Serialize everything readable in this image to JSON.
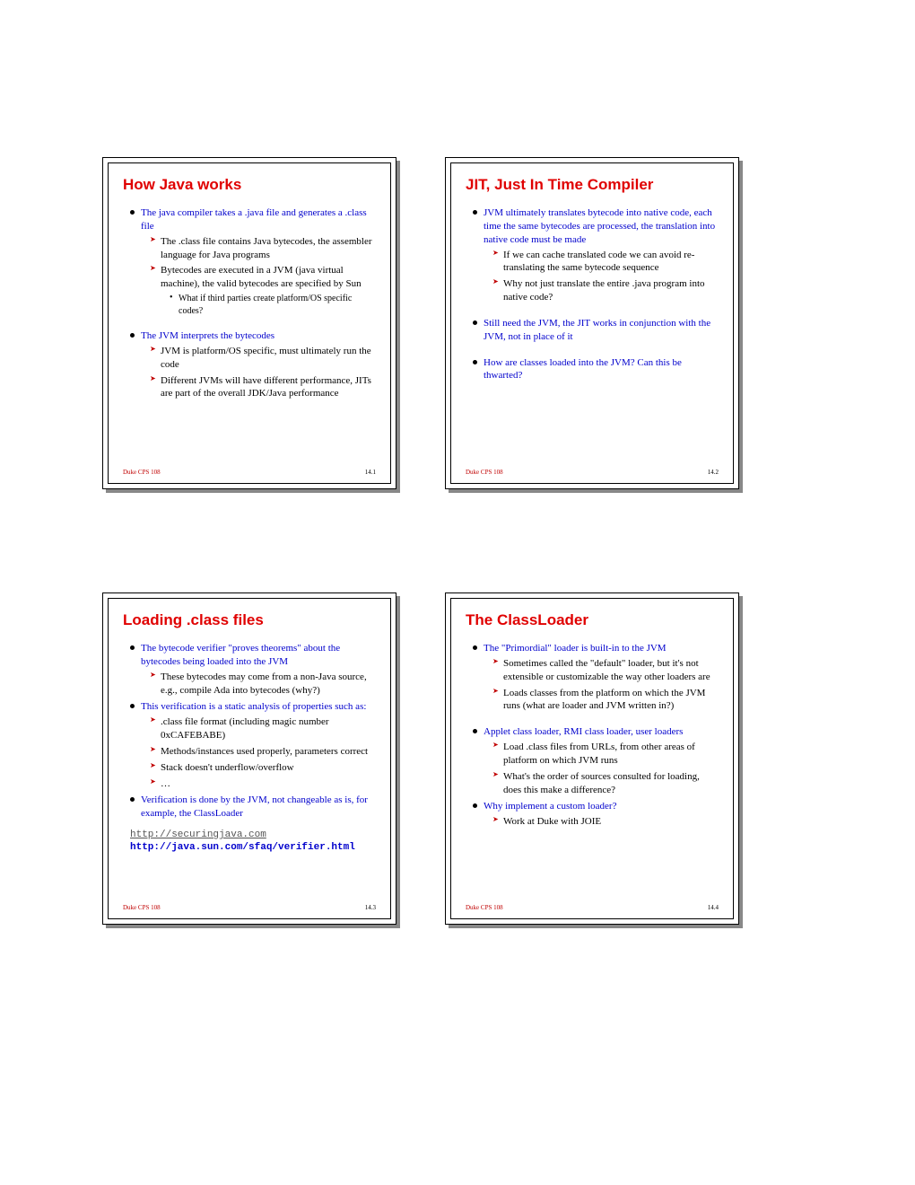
{
  "footer_course": "Duke CPS 108",
  "slides": [
    {
      "title": "How Java works",
      "page": "14.1",
      "bullets": [
        {
          "text": "The java compiler takes a .java file and generates a .class file",
          "sub": [
            {
              "text": "The .class file contains Java bytecodes, the assembler language for Java programs"
            },
            {
              "text": "Bytecodes are executed in a JVM (java virtual machine), the valid bytecodes are specified by Sun",
              "sub": [
                {
                  "text": "What if third parties create platform/OS specific codes?"
                }
              ]
            }
          ]
        },
        {
          "gap": true
        },
        {
          "text": "The JVM interprets the bytecodes",
          "sub": [
            {
              "text": "JVM is platform/OS specific, must ultimately run the code"
            },
            {
              "text": "Different JVMs will have different performance, JITs are part of the overall JDK/Java performance"
            }
          ]
        }
      ]
    },
    {
      "title": "JIT, Just In Time Compiler",
      "page": "14.2",
      "bullets": [
        {
          "text": "JVM ultimately translates bytecode into native code, each time the same bytecodes are processed, the translation into native code must be made",
          "sub": [
            {
              "text": "If we can cache translated code we can avoid re-translating the same bytecode sequence"
            },
            {
              "text": "Why not just translate the entire .java program into native code?"
            }
          ]
        },
        {
          "gap": true
        },
        {
          "text": "Still need the JVM, the JIT works in conjunction with the JVM, not in place of it"
        },
        {
          "gap": true
        },
        {
          "text": "How are classes loaded into the JVM? Can this be thwarted?"
        }
      ]
    },
    {
      "title": "Loading .class files",
      "page": "14.3",
      "bullets": [
        {
          "text": "The bytecode verifier \"proves theorems\" about the bytecodes being loaded into the JVM",
          "sub": [
            {
              "text": "These bytecodes may come from a non-Java source, e.g., compile Ada into bytecodes (why?)"
            }
          ]
        },
        {
          "text": "This verification is a static analysis of properties such as:",
          "sub": [
            {
              "text": ".class file format (including magic number 0xCAFEBABE)"
            },
            {
              "text": "Methods/instances used properly, parameters correct"
            },
            {
              "text": "Stack doesn't underflow/overflow"
            },
            {
              "text": "…"
            }
          ]
        },
        {
          "text": "Verification is done by the JVM, not changeable as is, for example, the ClassLoader"
        }
      ],
      "links": [
        {
          "text": "http://securingjava.com",
          "style": "plain"
        },
        {
          "text": "http://java.sun.com/sfaq/verifier.html",
          "style": "bold"
        }
      ]
    },
    {
      "title": "The ClassLoader",
      "page": "14.4",
      "bullets": [
        {
          "text": "The \"Primordial\" loader is built-in to the JVM",
          "sub": [
            {
              "text": "Sometimes called the \"default\" loader, but it's not extensible or customizable the way other loaders are"
            },
            {
              "text": "Loads classes from the platform on which the JVM runs (what are loader and JVM written in?)"
            }
          ]
        },
        {
          "gap": true
        },
        {
          "text": "Applet class loader, RMI class loader, user loaders",
          "sub": [
            {
              "text": "Load .class files from URLs, from other areas of platform on which JVM runs"
            },
            {
              "text": "What's the order of sources consulted for loading, does this make a difference?"
            }
          ]
        },
        {
          "text": "Why implement a custom loader?",
          "sub": [
            {
              "text": "Work at Duke with JOIE"
            }
          ]
        }
      ]
    }
  ]
}
